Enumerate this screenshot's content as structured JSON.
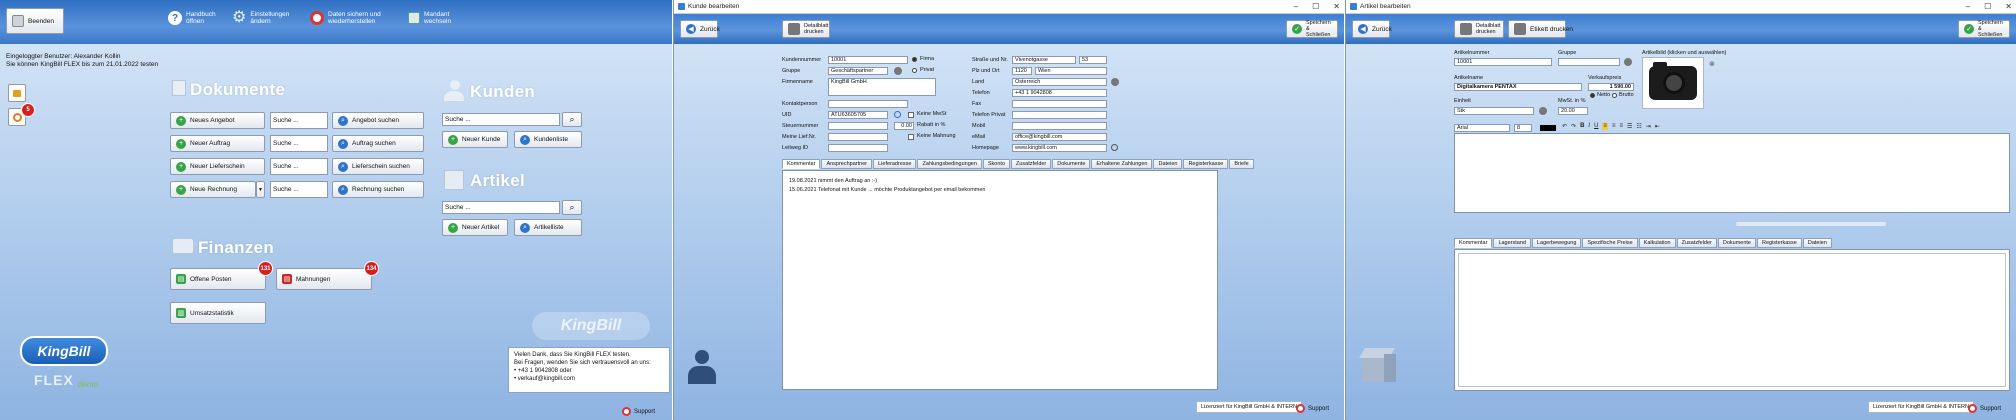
{
  "main": {
    "toolbar": {
      "beenden": "Beenden",
      "handbuch": "Handbuch öffnen",
      "einstellungen": "Einstellungen ändern",
      "daten": "Daten sichern und wiederherstellen",
      "mandant": "Mandant wechseln"
    },
    "login_line": "Eingeloggter Benutzer: Alexander Kollin",
    "test_line": "Sie können KingBill FLEX bis zum 21.01.2022 testen",
    "notif_badge": "5",
    "dokumente": {
      "heading": "Dokumente",
      "rows": [
        {
          "new": "Neues Angebot",
          "search_val": "Suche ...",
          "search_btn": "Angebot suchen"
        },
        {
          "new": "Neuer Auftrag",
          "search_val": "Suche ...",
          "search_btn": "Auftrag suchen"
        },
        {
          "new": "Neuer Lieferschein",
          "search_val": "Suche ...",
          "search_btn": "Lieferschein suchen"
        },
        {
          "new": "Neue Rechnung",
          "search_val": "Suche ...",
          "search_btn": "Rechnung suchen"
        }
      ]
    },
    "kunden": {
      "heading": "Kunden",
      "search_val": "Suche ...",
      "new": "Neuer Kunde",
      "list": "Kundenliste"
    },
    "artikel": {
      "heading": "Artikel",
      "search_val": "Suche ...",
      "new": "Neuer Artikel",
      "list": "Artikelliste"
    },
    "finanzen": {
      "heading": "Finanzen",
      "offene": "Offene Posten",
      "offene_badge": "131",
      "mahnungen": "Mahnungen",
      "mahnungen_badge": "134",
      "umsatz": "Umsatzstatistik"
    },
    "logo_king": "KingBill",
    "logo_flex": "FLEX",
    "logo_demo": "demo",
    "watermark": "KingBill",
    "info": {
      "line1": "Vielen Dank, dass Sie KingBill FLEX testen.",
      "line2": "Bei Fragen, wenden Sie sich vertrauensvoll an uns:",
      "line3": "• +43 1 9042808 oder",
      "line4": "• verkauf@kingbill.com"
    },
    "support": "Support"
  },
  "kunde": {
    "window_title": "Kunde bearbeiten",
    "back": "Zurück",
    "detail_print": "Detailblatt drucken",
    "save": "Speichern & Schließen",
    "labels": {
      "kundennummer": "Kundennummer",
      "gruppe": "Gruppe",
      "firmenname": "Firmenname",
      "kontaktperson": "Kontaktperson",
      "uid": "UID",
      "steuernummer": "Steuernummer",
      "meine_lief": "Meine Lief.Nr.",
      "leitweg": "Leitweg ID",
      "strasse": "Straße und Nr.",
      "plz": "Plz und Ort",
      "land": "Land",
      "telefon": "Telefon",
      "fax": "Fax",
      "telefon_privat": "Telefon Privat",
      "mobil": "Mobil",
      "email": "eMail",
      "homepage": "Homepage",
      "firma": "Firma",
      "privat": "Privat",
      "keine_mwst": "Keine MwSt",
      "rabatt": "Rabatt in %",
      "keine_mahnung": "Keine Mahnung"
    },
    "values": {
      "kundennummer": "10001",
      "gruppe": "Geschäftspartner",
      "firmenname": "KingBill GmbH",
      "kontaktperson": "",
      "uid": "ATU63605705",
      "steuernummer": "",
      "meine_lief": "",
      "leitweg": "",
      "strasse": "Vivenotgasse",
      "hausnr": "53",
      "plz": "1120",
      "ort": "Wien",
      "land": "Österreich",
      "telefon": "+43 1 9042808",
      "fax": "",
      "telefon_privat": "",
      "mobil": "",
      "email": "office@kingbill.com",
      "homepage": "www.kingbill.com",
      "rabatt": "0.00"
    },
    "tabs": [
      "Kommentar",
      "Ansprechpartner",
      "Lieferadresse",
      "Zahlungsbedingungen",
      "Skonto",
      "Zusatzfelder",
      "Dokumente",
      "Erhaltene Zahlungen",
      "Dateien",
      "Registerkasse",
      "Briefe"
    ],
    "comments": [
      "19.08.2021 nimmt den Auftrag an :-)",
      "15.06.2021 Telefonat mit Kunde ... möchte Produktangebot per email bekommen"
    ],
    "license": "Lizenziert für KingBill GmbH & INTERN",
    "support": "Support"
  },
  "artikel": {
    "window_title": "Artikel bearbeiten",
    "back": "Zurück",
    "detail_print": "Detailblatt drucken",
    "etikett": "Etikett drucken",
    "save": "Speichern & Schließen",
    "labels": {
      "artikelnummer": "Artikelnummer",
      "gruppe": "Gruppe",
      "artikelbild": "Artikelbild (klicken und auswählen)",
      "artikelname": "Artikelname",
      "verkaufspreis": "Verkaufspreis",
      "einheit": "Einheit",
      "mwst": "MwSt. in %",
      "netto": "Netto",
      "brutto": "Brutto"
    },
    "values": {
      "artikelnummer": "10001",
      "gruppe": "",
      "artikelname": "Digitalkamera PENTAX",
      "verkaufspreis": "1 590.00",
      "einheit": "Stk",
      "mwst": "20.00",
      "font": "Arial",
      "size": "8"
    },
    "tabs": [
      "Kommentar",
      "Lagerstand",
      "Lagerbewegung",
      "Spezifische Preise",
      "Kalkulation",
      "Zusatzfelder",
      "Dokumente",
      "Registerkasse",
      "Dateien"
    ],
    "license": "Lizenziert für KingBill GmbH & INTERN",
    "support": "Support"
  }
}
